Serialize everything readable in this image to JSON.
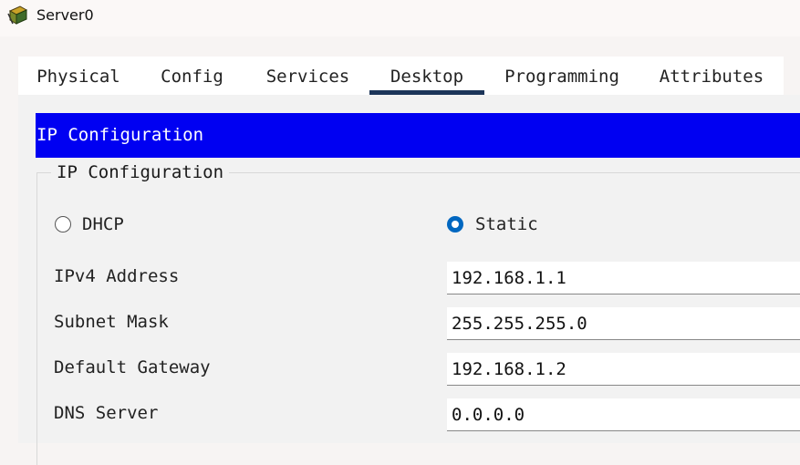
{
  "window": {
    "title": "Server0",
    "icon": "server-icon"
  },
  "tabs": [
    {
      "label": "Physical",
      "active": false
    },
    {
      "label": "Config",
      "active": false
    },
    {
      "label": "Services",
      "active": false
    },
    {
      "label": "Desktop",
      "active": true
    },
    {
      "label": "Programming",
      "active": false
    },
    {
      "label": "Attributes",
      "active": false
    }
  ],
  "panel": {
    "header": "IP Configuration",
    "group_label": "IP Configuration",
    "mode": {
      "options": [
        {
          "label": "DHCP",
          "selected": false
        },
        {
          "label": "Static",
          "selected": true
        }
      ]
    },
    "fields": [
      {
        "label": "IPv4 Address",
        "value": "192.168.1.1"
      },
      {
        "label": "Subnet Mask",
        "value": "255.255.255.0"
      },
      {
        "label": "Default Gateway",
        "value": "192.168.1.2"
      },
      {
        "label": "DNS Server",
        "value": "0.0.0.0"
      }
    ]
  },
  "colors": {
    "header_bg": "#0000f2",
    "active_tab_underline": "#1c3559",
    "radio_selected": "#0067c0"
  }
}
